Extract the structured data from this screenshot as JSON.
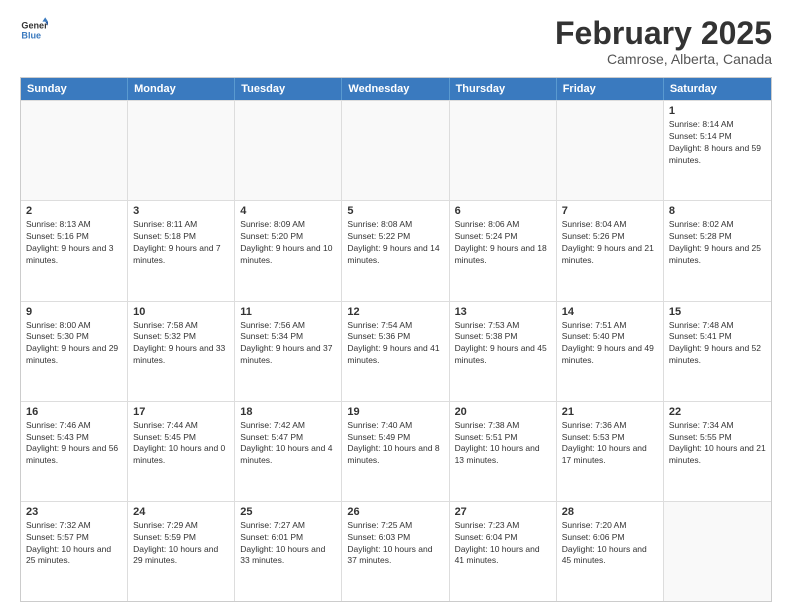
{
  "header": {
    "logo_general": "General",
    "logo_blue": "Blue",
    "title": "February 2025",
    "subtitle": "Camrose, Alberta, Canada"
  },
  "days_of_week": [
    "Sunday",
    "Monday",
    "Tuesday",
    "Wednesday",
    "Thursday",
    "Friday",
    "Saturday"
  ],
  "weeks": [
    [
      {
        "num": "",
        "empty": true,
        "info": ""
      },
      {
        "num": "",
        "empty": true,
        "info": ""
      },
      {
        "num": "",
        "empty": true,
        "info": ""
      },
      {
        "num": "",
        "empty": true,
        "info": ""
      },
      {
        "num": "",
        "empty": true,
        "info": ""
      },
      {
        "num": "",
        "empty": true,
        "info": ""
      },
      {
        "num": "1",
        "empty": false,
        "info": "Sunrise: 8:14 AM\nSunset: 5:14 PM\nDaylight: 8 hours and 59 minutes."
      }
    ],
    [
      {
        "num": "2",
        "empty": false,
        "info": "Sunrise: 8:13 AM\nSunset: 5:16 PM\nDaylight: 9 hours and 3 minutes."
      },
      {
        "num": "3",
        "empty": false,
        "info": "Sunrise: 8:11 AM\nSunset: 5:18 PM\nDaylight: 9 hours and 7 minutes."
      },
      {
        "num": "4",
        "empty": false,
        "info": "Sunrise: 8:09 AM\nSunset: 5:20 PM\nDaylight: 9 hours and 10 minutes."
      },
      {
        "num": "5",
        "empty": false,
        "info": "Sunrise: 8:08 AM\nSunset: 5:22 PM\nDaylight: 9 hours and 14 minutes."
      },
      {
        "num": "6",
        "empty": false,
        "info": "Sunrise: 8:06 AM\nSunset: 5:24 PM\nDaylight: 9 hours and 18 minutes."
      },
      {
        "num": "7",
        "empty": false,
        "info": "Sunrise: 8:04 AM\nSunset: 5:26 PM\nDaylight: 9 hours and 21 minutes."
      },
      {
        "num": "8",
        "empty": false,
        "info": "Sunrise: 8:02 AM\nSunset: 5:28 PM\nDaylight: 9 hours and 25 minutes."
      }
    ],
    [
      {
        "num": "9",
        "empty": false,
        "info": "Sunrise: 8:00 AM\nSunset: 5:30 PM\nDaylight: 9 hours and 29 minutes."
      },
      {
        "num": "10",
        "empty": false,
        "info": "Sunrise: 7:58 AM\nSunset: 5:32 PM\nDaylight: 9 hours and 33 minutes."
      },
      {
        "num": "11",
        "empty": false,
        "info": "Sunrise: 7:56 AM\nSunset: 5:34 PM\nDaylight: 9 hours and 37 minutes."
      },
      {
        "num": "12",
        "empty": false,
        "info": "Sunrise: 7:54 AM\nSunset: 5:36 PM\nDaylight: 9 hours and 41 minutes."
      },
      {
        "num": "13",
        "empty": false,
        "info": "Sunrise: 7:53 AM\nSunset: 5:38 PM\nDaylight: 9 hours and 45 minutes."
      },
      {
        "num": "14",
        "empty": false,
        "info": "Sunrise: 7:51 AM\nSunset: 5:40 PM\nDaylight: 9 hours and 49 minutes."
      },
      {
        "num": "15",
        "empty": false,
        "info": "Sunrise: 7:48 AM\nSunset: 5:41 PM\nDaylight: 9 hours and 52 minutes."
      }
    ],
    [
      {
        "num": "16",
        "empty": false,
        "info": "Sunrise: 7:46 AM\nSunset: 5:43 PM\nDaylight: 9 hours and 56 minutes."
      },
      {
        "num": "17",
        "empty": false,
        "info": "Sunrise: 7:44 AM\nSunset: 5:45 PM\nDaylight: 10 hours and 0 minutes."
      },
      {
        "num": "18",
        "empty": false,
        "info": "Sunrise: 7:42 AM\nSunset: 5:47 PM\nDaylight: 10 hours and 4 minutes."
      },
      {
        "num": "19",
        "empty": false,
        "info": "Sunrise: 7:40 AM\nSunset: 5:49 PM\nDaylight: 10 hours and 8 minutes."
      },
      {
        "num": "20",
        "empty": false,
        "info": "Sunrise: 7:38 AM\nSunset: 5:51 PM\nDaylight: 10 hours and 13 minutes."
      },
      {
        "num": "21",
        "empty": false,
        "info": "Sunrise: 7:36 AM\nSunset: 5:53 PM\nDaylight: 10 hours and 17 minutes."
      },
      {
        "num": "22",
        "empty": false,
        "info": "Sunrise: 7:34 AM\nSunset: 5:55 PM\nDaylight: 10 hours and 21 minutes."
      }
    ],
    [
      {
        "num": "23",
        "empty": false,
        "info": "Sunrise: 7:32 AM\nSunset: 5:57 PM\nDaylight: 10 hours and 25 minutes."
      },
      {
        "num": "24",
        "empty": false,
        "info": "Sunrise: 7:29 AM\nSunset: 5:59 PM\nDaylight: 10 hours and 29 minutes."
      },
      {
        "num": "25",
        "empty": false,
        "info": "Sunrise: 7:27 AM\nSunset: 6:01 PM\nDaylight: 10 hours and 33 minutes."
      },
      {
        "num": "26",
        "empty": false,
        "info": "Sunrise: 7:25 AM\nSunset: 6:03 PM\nDaylight: 10 hours and 37 minutes."
      },
      {
        "num": "27",
        "empty": false,
        "info": "Sunrise: 7:23 AM\nSunset: 6:04 PM\nDaylight: 10 hours and 41 minutes."
      },
      {
        "num": "28",
        "empty": false,
        "info": "Sunrise: 7:20 AM\nSunset: 6:06 PM\nDaylight: 10 hours and 45 minutes."
      },
      {
        "num": "",
        "empty": true,
        "info": ""
      }
    ]
  ]
}
